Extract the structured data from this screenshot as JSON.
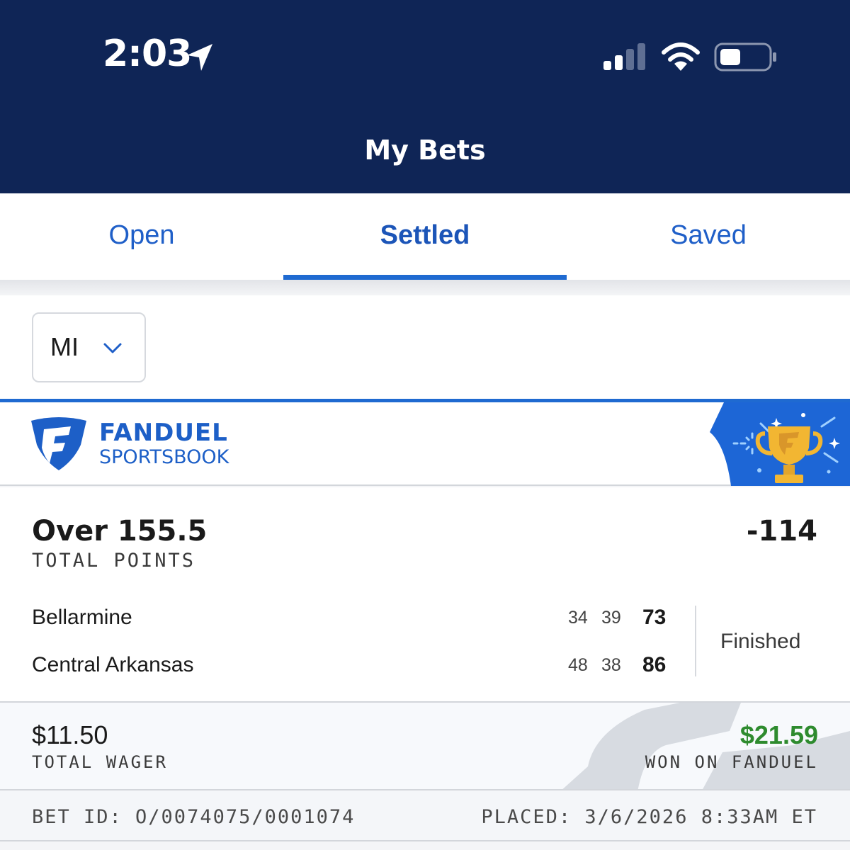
{
  "status_bar": {
    "time": "2:03",
    "icons": [
      "location-arrow-icon",
      "cellular-signal-icon",
      "wifi-icon",
      "battery-icon"
    ]
  },
  "header": {
    "title": "My Bets"
  },
  "tabs": [
    {
      "label": "Open",
      "active": false
    },
    {
      "label": "Settled",
      "active": true
    },
    {
      "label": "Saved",
      "active": false
    }
  ],
  "filter": {
    "state": "MI"
  },
  "brand": {
    "name": "FANDUEL",
    "sub": "SPORTSBOOK"
  },
  "bet": {
    "selection": "Over 155.5",
    "market": "TOTAL POINTS",
    "odds": "-114",
    "status": "Finished",
    "teams": [
      {
        "name": "Bellarmine",
        "h1": "34",
        "h2": "39",
        "total": "73"
      },
      {
        "name": "Central Arkansas",
        "h1": "48",
        "h2": "38",
        "total": "86"
      }
    ]
  },
  "payout": {
    "wager_amount": "$11.50",
    "wager_label": "TOTAL WAGER",
    "won_amount": "$21.59",
    "won_label": "WON ON FANDUEL"
  },
  "footer": {
    "bet_id": "BET ID: O/0074075/0001074",
    "placed": "PLACED: 3/6/2026 8:33AM ET"
  },
  "colors": {
    "header_bg": "#0f2556",
    "accent_blue": "#1f6ad1",
    "won_green": "#2e8b2e",
    "trophy_gold": "#f2b632"
  }
}
